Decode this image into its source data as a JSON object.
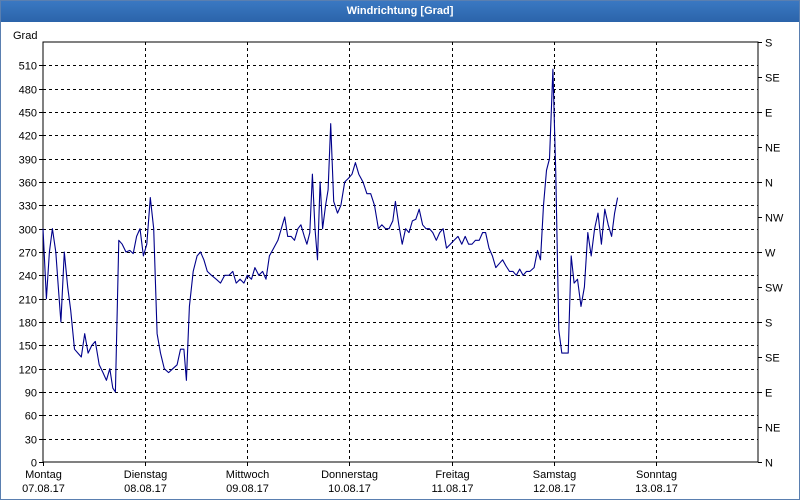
{
  "window": {
    "title": "Windrichtung [Grad]"
  },
  "chart_data": {
    "type": "line",
    "ylabel": "Grad",
    "ylim": [
      0,
      540
    ],
    "yticks": [
      0,
      30,
      60,
      90,
      120,
      150,
      180,
      210,
      240,
      270,
      300,
      330,
      360,
      390,
      420,
      450,
      480,
      510
    ],
    "right_axis_labels": [
      "N",
      "NE",
      "E",
      "SE",
      "S",
      "SW",
      "W",
      "NW",
      "N",
      "NE",
      "E",
      "SE",
      "S"
    ],
    "days": [
      {
        "name": "Montag",
        "date": "07.08.17"
      },
      {
        "name": "Dienstag",
        "date": "08.08.17"
      },
      {
        "name": "Mittwoch",
        "date": "09.08.17"
      },
      {
        "name": "Donnerstag",
        "date": "10.08.17"
      },
      {
        "name": "Freitag",
        "date": "11.08.17"
      },
      {
        "name": "Samstag",
        "date": "12.08.17"
      },
      {
        "name": "Sonntag",
        "date": "13.08.17"
      }
    ],
    "x_unit": "hours since 07.08.17 00:00",
    "xlim": [
      0,
      168
    ],
    "series": [
      {
        "color": "#00008b",
        "points": [
          [
            0.0,
            300
          ],
          [
            0.8,
            210
          ],
          [
            1.5,
            270
          ],
          [
            2.2,
            300
          ],
          [
            3.0,
            270
          ],
          [
            3.6,
            225
          ],
          [
            4.2,
            180
          ],
          [
            5.0,
            270
          ],
          [
            5.8,
            225
          ],
          [
            6.5,
            195
          ],
          [
            7.4,
            145
          ],
          [
            8.2,
            140
          ],
          [
            9.0,
            135
          ],
          [
            9.8,
            165
          ],
          [
            10.6,
            140
          ],
          [
            11.5,
            150
          ],
          [
            12.3,
            155
          ],
          [
            13.2,
            125
          ],
          [
            14.1,
            115
          ],
          [
            14.9,
            105
          ],
          [
            15.7,
            120
          ],
          [
            16.4,
            95
          ],
          [
            17.0,
            90
          ],
          [
            17.8,
            285
          ],
          [
            18.6,
            280
          ],
          [
            19.5,
            270
          ],
          [
            20.4,
            272
          ],
          [
            21.2,
            268
          ],
          [
            22.0,
            290
          ],
          [
            22.8,
            300
          ],
          [
            23.6,
            265
          ],
          [
            24.4,
            280
          ],
          [
            25.2,
            340
          ],
          [
            26.0,
            300
          ],
          [
            26.8,
            165
          ],
          [
            27.6,
            140
          ],
          [
            28.5,
            120
          ],
          [
            29.5,
            115
          ],
          [
            30.5,
            120
          ],
          [
            31.5,
            125
          ],
          [
            32.3,
            145
          ],
          [
            33.1,
            145
          ],
          [
            33.7,
            105
          ],
          [
            34.4,
            200
          ],
          [
            35.3,
            245
          ],
          [
            36.2,
            265
          ],
          [
            37.0,
            270
          ],
          [
            37.8,
            260
          ],
          [
            38.6,
            245
          ],
          [
            39.6,
            240
          ],
          [
            40.7,
            235
          ],
          [
            41.7,
            230
          ],
          [
            42.7,
            240
          ],
          [
            43.7,
            240
          ],
          [
            44.6,
            245
          ],
          [
            45.4,
            230
          ],
          [
            46.3,
            235
          ],
          [
            47.2,
            230
          ],
          [
            48.0,
            240
          ],
          [
            49.0,
            235
          ],
          [
            49.8,
            250
          ],
          [
            50.7,
            240
          ],
          [
            51.6,
            245
          ],
          [
            52.4,
            235
          ],
          [
            53.2,
            265
          ],
          [
            54.2,
            275
          ],
          [
            55.2,
            285
          ],
          [
            56.0,
            300
          ],
          [
            56.8,
            315
          ],
          [
            57.5,
            290
          ],
          [
            58.3,
            290
          ],
          [
            59.1,
            285
          ],
          [
            59.9,
            300
          ],
          [
            60.6,
            305
          ],
          [
            61.4,
            290
          ],
          [
            62.0,
            280
          ],
          [
            62.7,
            295
          ],
          [
            63.3,
            370
          ],
          [
            63.9,
            300
          ],
          [
            64.5,
            260
          ],
          [
            65.1,
            360
          ],
          [
            65.7,
            300
          ],
          [
            66.4,
            330
          ],
          [
            67.0,
            350
          ],
          [
            67.6,
            435
          ],
          [
            68.3,
            335
          ],
          [
            69.2,
            320
          ],
          [
            70.0,
            330
          ],
          [
            70.9,
            360
          ],
          [
            71.8,
            365
          ],
          [
            72.6,
            370
          ],
          [
            73.4,
            385
          ],
          [
            74.2,
            370
          ],
          [
            75.2,
            360
          ],
          [
            76.1,
            345
          ],
          [
            77.0,
            345
          ],
          [
            77.9,
            330
          ],
          [
            78.8,
            300
          ],
          [
            79.6,
            305
          ],
          [
            80.5,
            300
          ],
          [
            81.3,
            300
          ],
          [
            82.2,
            310
          ],
          [
            82.8,
            335
          ],
          [
            83.6,
            305
          ],
          [
            84.4,
            280
          ],
          [
            85.2,
            300
          ],
          [
            86.0,
            295
          ],
          [
            86.8,
            310
          ],
          [
            87.6,
            312
          ],
          [
            88.4,
            325
          ],
          [
            89.2,
            305
          ],
          [
            90.0,
            300
          ],
          [
            90.8,
            300
          ],
          [
            91.6,
            295
          ],
          [
            92.4,
            285
          ],
          [
            93.2,
            295
          ],
          [
            94.0,
            300
          ],
          [
            94.8,
            275
          ],
          [
            95.7,
            280
          ],
          [
            96.6,
            285
          ],
          [
            97.5,
            290
          ],
          [
            98.4,
            280
          ],
          [
            99.2,
            290
          ],
          [
            100.0,
            280
          ],
          [
            100.8,
            280
          ],
          [
            101.6,
            285
          ],
          [
            102.5,
            285
          ],
          [
            103.3,
            295
          ],
          [
            104.0,
            295
          ],
          [
            104.8,
            275
          ],
          [
            105.6,
            265
          ],
          [
            106.4,
            250
          ],
          [
            107.2,
            255
          ],
          [
            108.0,
            260
          ],
          [
            108.8,
            252
          ],
          [
            109.6,
            245
          ],
          [
            110.4,
            245
          ],
          [
            111.2,
            240
          ],
          [
            112.0,
            248
          ],
          [
            112.8,
            240
          ],
          [
            113.6,
            245
          ],
          [
            114.4,
            245
          ],
          [
            115.4,
            250
          ],
          [
            116.2,
            272
          ],
          [
            116.9,
            260
          ],
          [
            117.6,
            330
          ],
          [
            118.3,
            375
          ],
          [
            119.0,
            390
          ],
          [
            119.8,
            505
          ],
          [
            120.5,
            370
          ],
          [
            121.2,
            170
          ],
          [
            121.9,
            140
          ],
          [
            122.6,
            140
          ],
          [
            123.4,
            140
          ],
          [
            124.1,
            265
          ],
          [
            124.8,
            230
          ],
          [
            125.6,
            235
          ],
          [
            126.4,
            200
          ],
          [
            127.2,
            225
          ],
          [
            128.0,
            295
          ],
          [
            128.8,
            265
          ],
          [
            129.6,
            300
          ],
          [
            130.4,
            320
          ],
          [
            131.2,
            280
          ],
          [
            132.0,
            325
          ],
          [
            132.8,
            305
          ],
          [
            133.6,
            290
          ],
          [
            134.3,
            320
          ],
          [
            135.0,
            340
          ]
        ]
      }
    ]
  }
}
